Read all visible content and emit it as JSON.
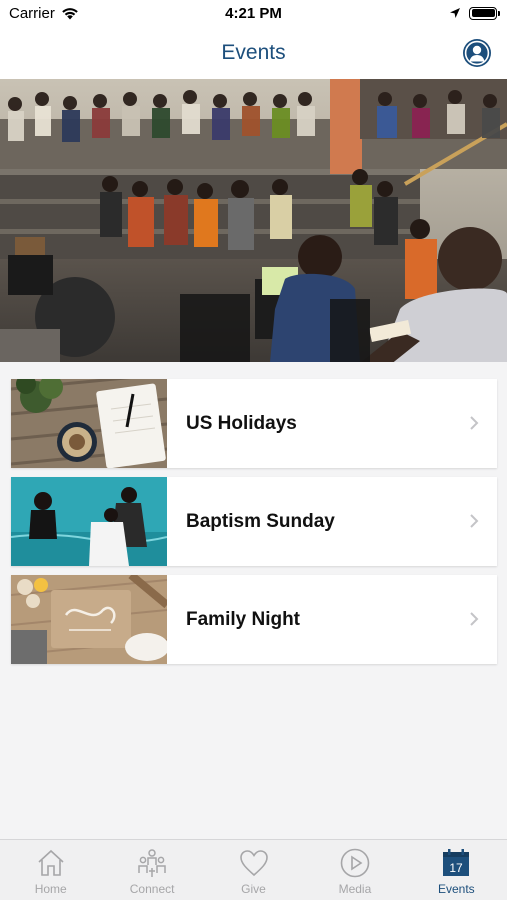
{
  "status_bar": {
    "carrier": "Carrier",
    "time": "4:21 PM"
  },
  "nav": {
    "title": "Events"
  },
  "colors": {
    "brand": "#1d4f7c",
    "inactive": "#a6a6a8",
    "background": "#f4f4f5"
  },
  "events": [
    {
      "title": "US Holidays"
    },
    {
      "title": "Baptism Sunday"
    },
    {
      "title": "Family Night"
    }
  ],
  "tabs": [
    {
      "label": "Home",
      "icon": "home-icon"
    },
    {
      "label": "Connect",
      "icon": "people-icon"
    },
    {
      "label": "Give",
      "icon": "heart-icon"
    },
    {
      "label": "Media",
      "icon": "play-icon"
    },
    {
      "label": "Events",
      "icon": "calendar-icon",
      "active": true,
      "calendar_day": "17"
    }
  ]
}
